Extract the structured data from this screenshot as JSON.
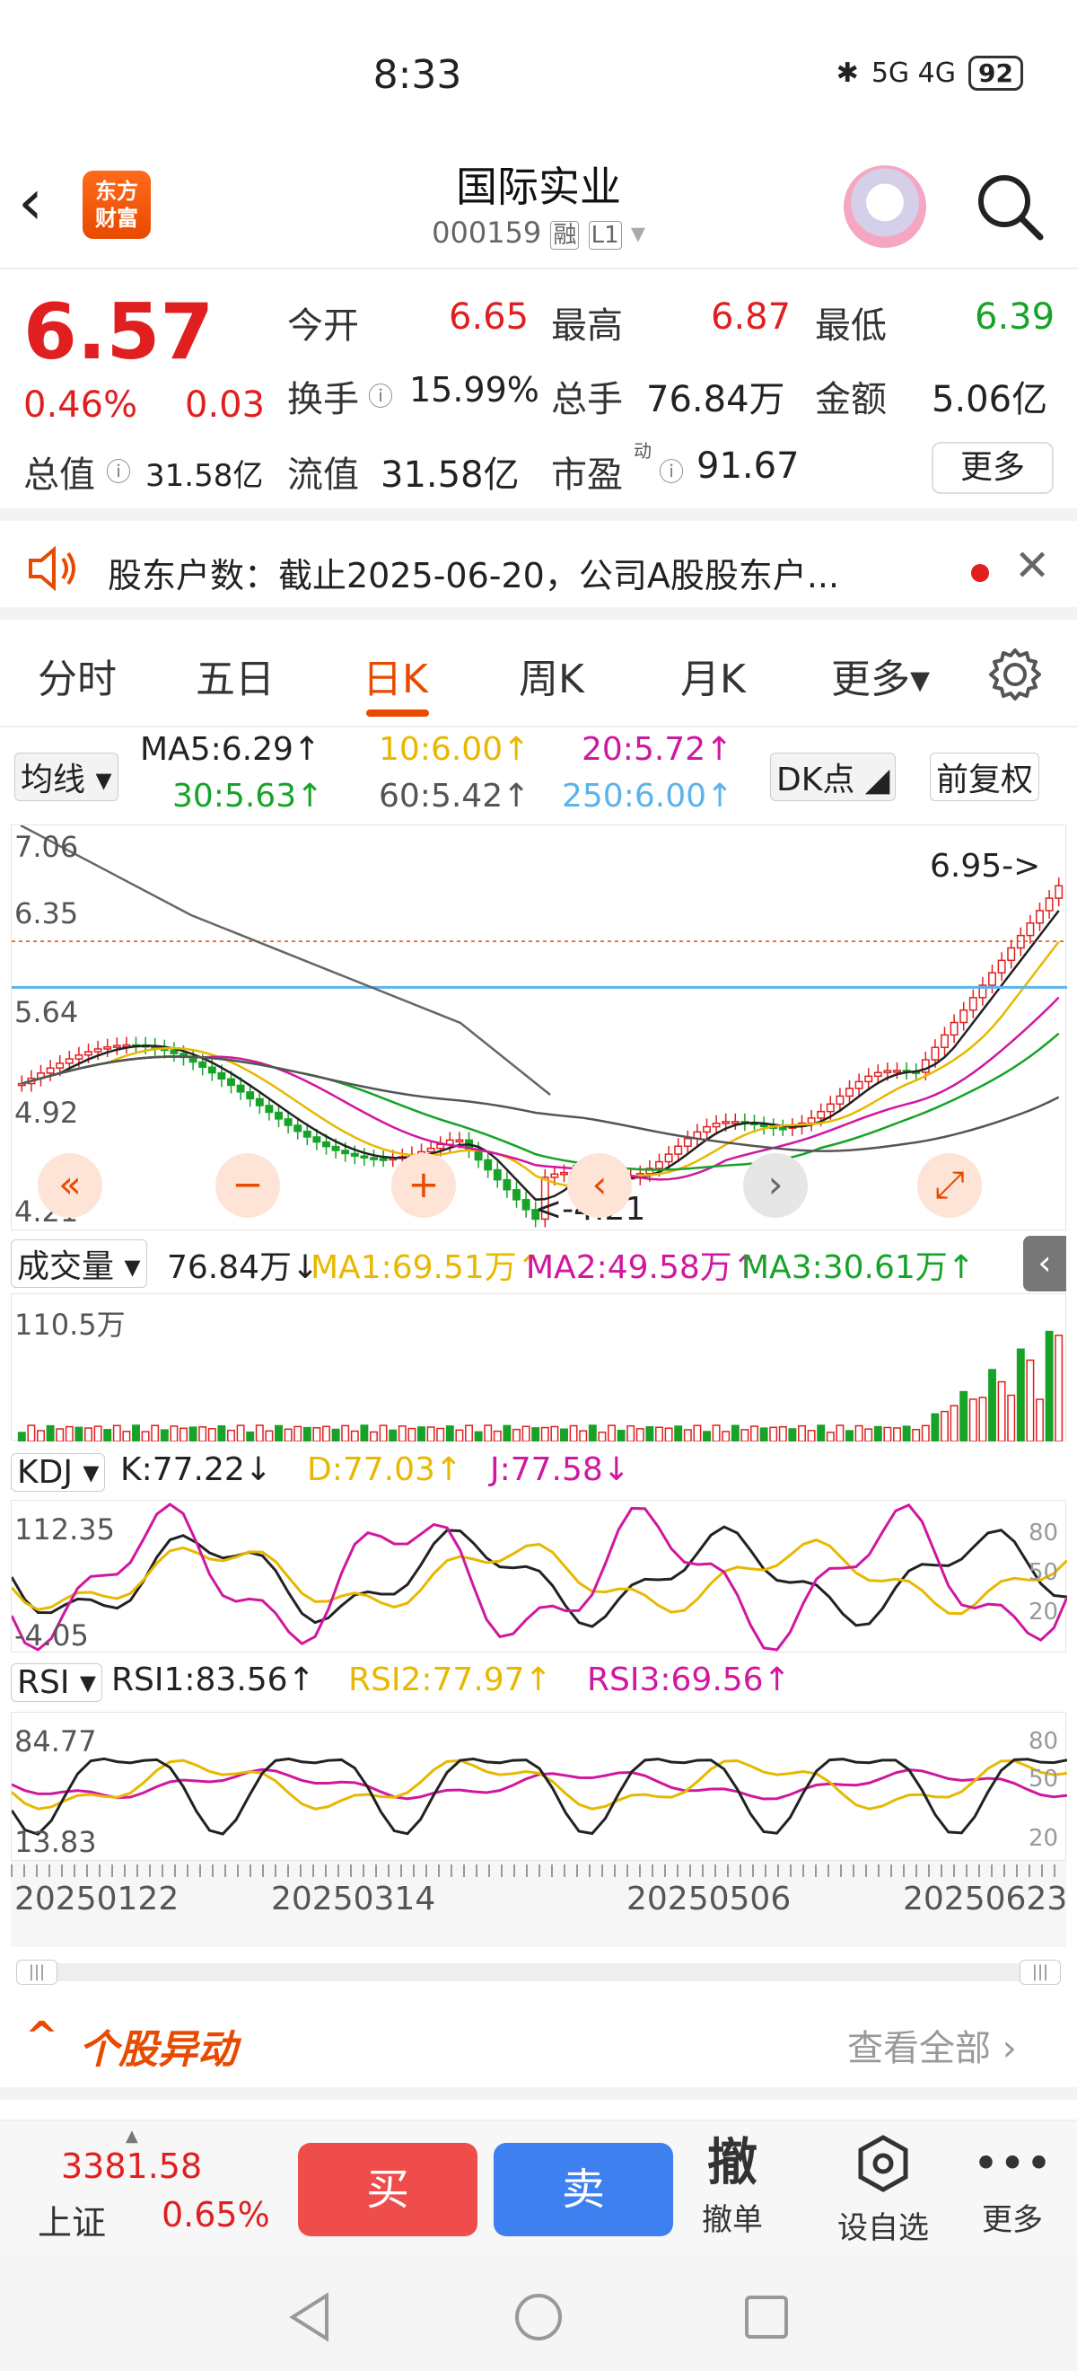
{
  "status": {
    "time": "8:33",
    "signal": "5G 4G",
    "battery": "92"
  },
  "header": {
    "name": "国际实业",
    "code": "000159",
    "tag_rong": "融",
    "tag_level": "L1",
    "logo_line1": "东方",
    "logo_line2": "财富"
  },
  "quote": {
    "price": "6.57",
    "pct": "0.46%",
    "change": "0.03",
    "open_label": "今开",
    "open": "6.65",
    "high_label": "最高",
    "high": "6.87",
    "low_label": "最低",
    "low": "6.39",
    "turnover_label": "换手",
    "turnover": "15.99%",
    "volume_label": "总手",
    "volume": "76.84万",
    "amount_label": "金额",
    "amount": "5.06亿",
    "mktcap_label": "总值",
    "mktcap": "31.58亿",
    "float_label": "流值",
    "float_cap": "31.58亿",
    "pe_label": "市盈",
    "pe_sup": "动",
    "pe": "91.67",
    "more": "更多"
  },
  "notice": {
    "text": "股东户数：截止2025-06-20，公司A股股东户..."
  },
  "tabs": [
    "分时",
    "五日",
    "日K",
    "周K",
    "月K",
    "更多▾"
  ],
  "ma": {
    "selector": "均线",
    "ma5": "MA5:6.29↑",
    "ma10": "10:6.00↑",
    "ma20": "20:5.72↑",
    "ma30": "30:5.63↑",
    "ma60": "60:5.42↑",
    "ma250": "250:6.00↑",
    "dk": "DK点",
    "adjust": "前复权"
  },
  "kline": {
    "y_labels": [
      "7.06",
      "6.35",
      "5.64",
      "4.92",
      "4.21"
    ],
    "high_marker": "6.95->",
    "low_marker": "<-4.21"
  },
  "volume": {
    "selector": "成交量",
    "value": "76.84万↓",
    "ma1": "MA1:69.51万↑",
    "ma2": "MA2:49.58万↑",
    "ma3": "MA3:30.61万↑",
    "max_label": "110.5万"
  },
  "kdj": {
    "selector": "KDJ",
    "k": "K:77.22↓",
    "d": "D:77.03↑",
    "j": "J:77.58↓",
    "top": "112.35",
    "bottom": "-4.05",
    "r80": "80",
    "r50": "50",
    "r20": "20"
  },
  "rsi": {
    "selector": "RSI",
    "rsi1": "RSI1:83.56↑",
    "rsi2": "RSI2:77.97↑",
    "rsi3": "RSI3:69.56↑",
    "top": "84.77",
    "bottom": "13.83",
    "r80": "80",
    "r50": "50",
    "r20": "20"
  },
  "dates": [
    "20250122",
    "20250314",
    "20250506",
    "20250623"
  ],
  "section": {
    "title": "个股异动",
    "view_all": "查看全部"
  },
  "bottom": {
    "index_value": "3381.58",
    "index_name": "上证",
    "index_pct": "0.65%",
    "buy": "买",
    "sell": "卖",
    "cancel_big": "撤",
    "cancel": "撤单",
    "watch": "设自选",
    "more": "更多"
  },
  "colors": {
    "up": "#e02020",
    "down": "#17a328",
    "accent": "#e84a00",
    "ma10": "#e8b800",
    "ma20": "#d0179f",
    "ma250": "#5cb3ec"
  }
}
